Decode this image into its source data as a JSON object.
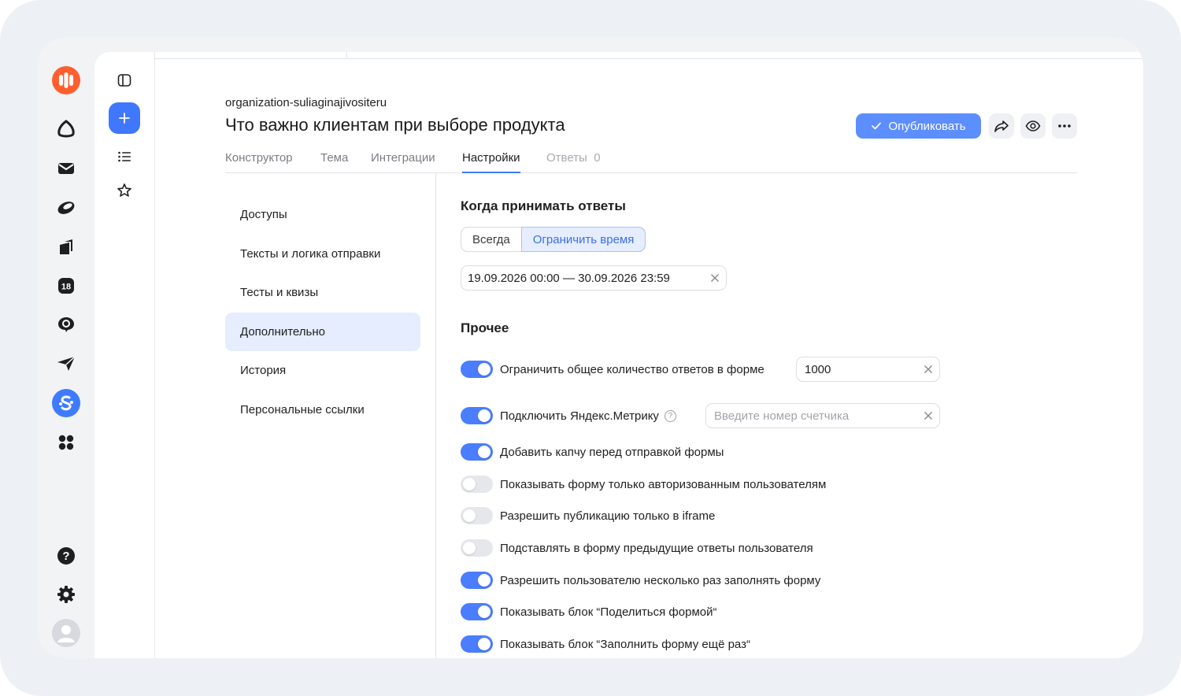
{
  "rail": {
    "icons": [
      "logo-icon",
      "alice-icon",
      "mail-icon",
      "disk-icon",
      "docs-icon",
      "calendar-icon",
      "messenger-icon",
      "telemost-icon",
      "forms-icon",
      "apps-icon",
      "help-icon",
      "settings-icon",
      "avatar-icon"
    ],
    "calendar_day": "18"
  },
  "sidebar2": {
    "icons": [
      "panel-toggle-icon",
      "plus-icon",
      "list-icon",
      "star-icon"
    ]
  },
  "header": {
    "org": "organization-suliaginajivositeru",
    "title": "Что важно клиентам при выборе продукта",
    "publish_label": "Опубликовать",
    "accent_color": "#5c8eff"
  },
  "tabs": [
    {
      "label": "Конструктор"
    },
    {
      "label": "Тема"
    },
    {
      "label": "Интеграции"
    },
    {
      "label": "Настройки",
      "active": true
    },
    {
      "label": "Ответы",
      "count": "0",
      "disabled": true
    }
  ],
  "nav": {
    "items": [
      {
        "label": "Доступы"
      },
      {
        "label": "Тексты и логика отправки"
      },
      {
        "label": "Тесты и квизы"
      },
      {
        "label": "Дополнительно",
        "active": true
      },
      {
        "label": "История"
      },
      {
        "label": "Персональные ссылки"
      }
    ]
  },
  "settings": {
    "when_title": "Когда принимать ответы",
    "segment": {
      "always": "Всегда",
      "limit": "Ограничить время",
      "selected": "limit"
    },
    "date_range": "19.09.2026 00:00 — 30.09.2026 23:59",
    "other_title": "Прочее",
    "max_answers_value": "1000",
    "metrika_placeholder": "Введите номер счетчика",
    "toggles": [
      {
        "label": "Ограничить общее количество ответов в форме",
        "on": true
      },
      {
        "label": "Подключить Яндекс.Метрику",
        "on": true
      },
      {
        "label": "Добавить капчу перед отправкой формы",
        "on": true
      },
      {
        "label": "Показывать форму только авторизованным пользователям",
        "on": false
      },
      {
        "label": "Разрешить публикацию только в iframe",
        "on": false
      },
      {
        "label": "Подставлять в форму предыдущие ответы пользователя",
        "on": false
      },
      {
        "label": "Разрешить пользователю несколько раз заполнять форму",
        "on": true
      },
      {
        "label": "Показывать блок “Поделиться формой“",
        "on": true
      },
      {
        "label": "Показывать блок “Заполнить форму ещё раз“",
        "on": true
      }
    ]
  }
}
